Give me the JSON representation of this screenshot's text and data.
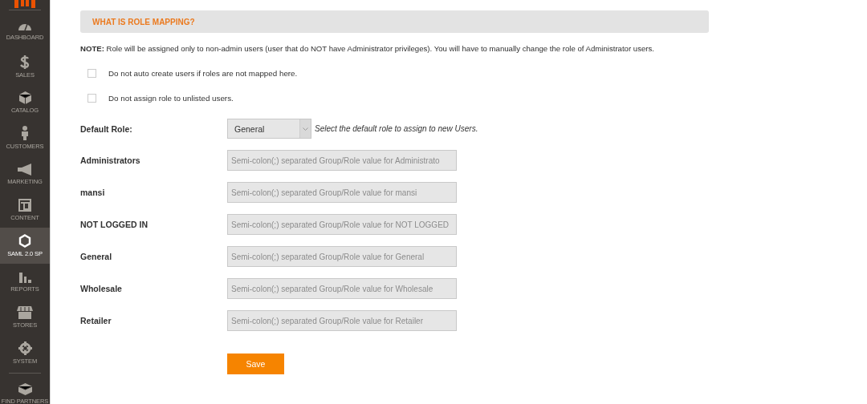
{
  "sidebar": {
    "items": [
      {
        "label": "DASHBOARD",
        "selected": false
      },
      {
        "label": "SALES",
        "selected": false
      },
      {
        "label": "CATALOG",
        "selected": false
      },
      {
        "label": "CUSTOMERS",
        "selected": false
      },
      {
        "label": "MARKETING",
        "selected": false
      },
      {
        "label": "CONTENT",
        "selected": false
      },
      {
        "label": "SAML 2.0 SP",
        "selected": true
      },
      {
        "label": "REPORTS",
        "selected": false
      },
      {
        "label": "STORES",
        "selected": false
      },
      {
        "label": "SYSTEM",
        "selected": false
      },
      {
        "label": "FIND PARTNERS",
        "selected": false
      }
    ]
  },
  "section": {
    "title": "WHAT IS ROLE MAPPING?"
  },
  "note": "**NOTE:** Role will be assigned only to non-admin users (user that do NOT have Administrator privileges). You will have to manually change the role of Administrator users.",
  "options": [
    {
      "label": "Do not auto create users if roles are not mapped here.",
      "checked": false
    },
    {
      "label": "Do not assign role to unlisted users.",
      "checked": false
    }
  ],
  "default_role": {
    "label": "Default Role:",
    "value": "General",
    "hint": "Select the default role to assign to new Users."
  },
  "mappings": [
    {
      "label": "Administrators",
      "placeholder": "Semi-colon(;) separated Group/Role value for Administrato"
    },
    {
      "label": "mansi",
      "placeholder": "Semi-colon(;) separated Group/Role value for mansi"
    },
    {
      "label": "NOT LOGGED IN",
      "placeholder": "Semi-colon(;) separated Group/Role value for NOT LOGGED"
    },
    {
      "label": "General",
      "placeholder": "Semi-colon(;) separated Group/Role value for General"
    },
    {
      "label": "Wholesale",
      "placeholder": "Semi-colon(;) separated Group/Role value for Wholesale"
    },
    {
      "label": "Retailer",
      "placeholder": "Semi-colon(;) separated Group/Role value for Retailer"
    }
  ],
  "save_button": "Save"
}
